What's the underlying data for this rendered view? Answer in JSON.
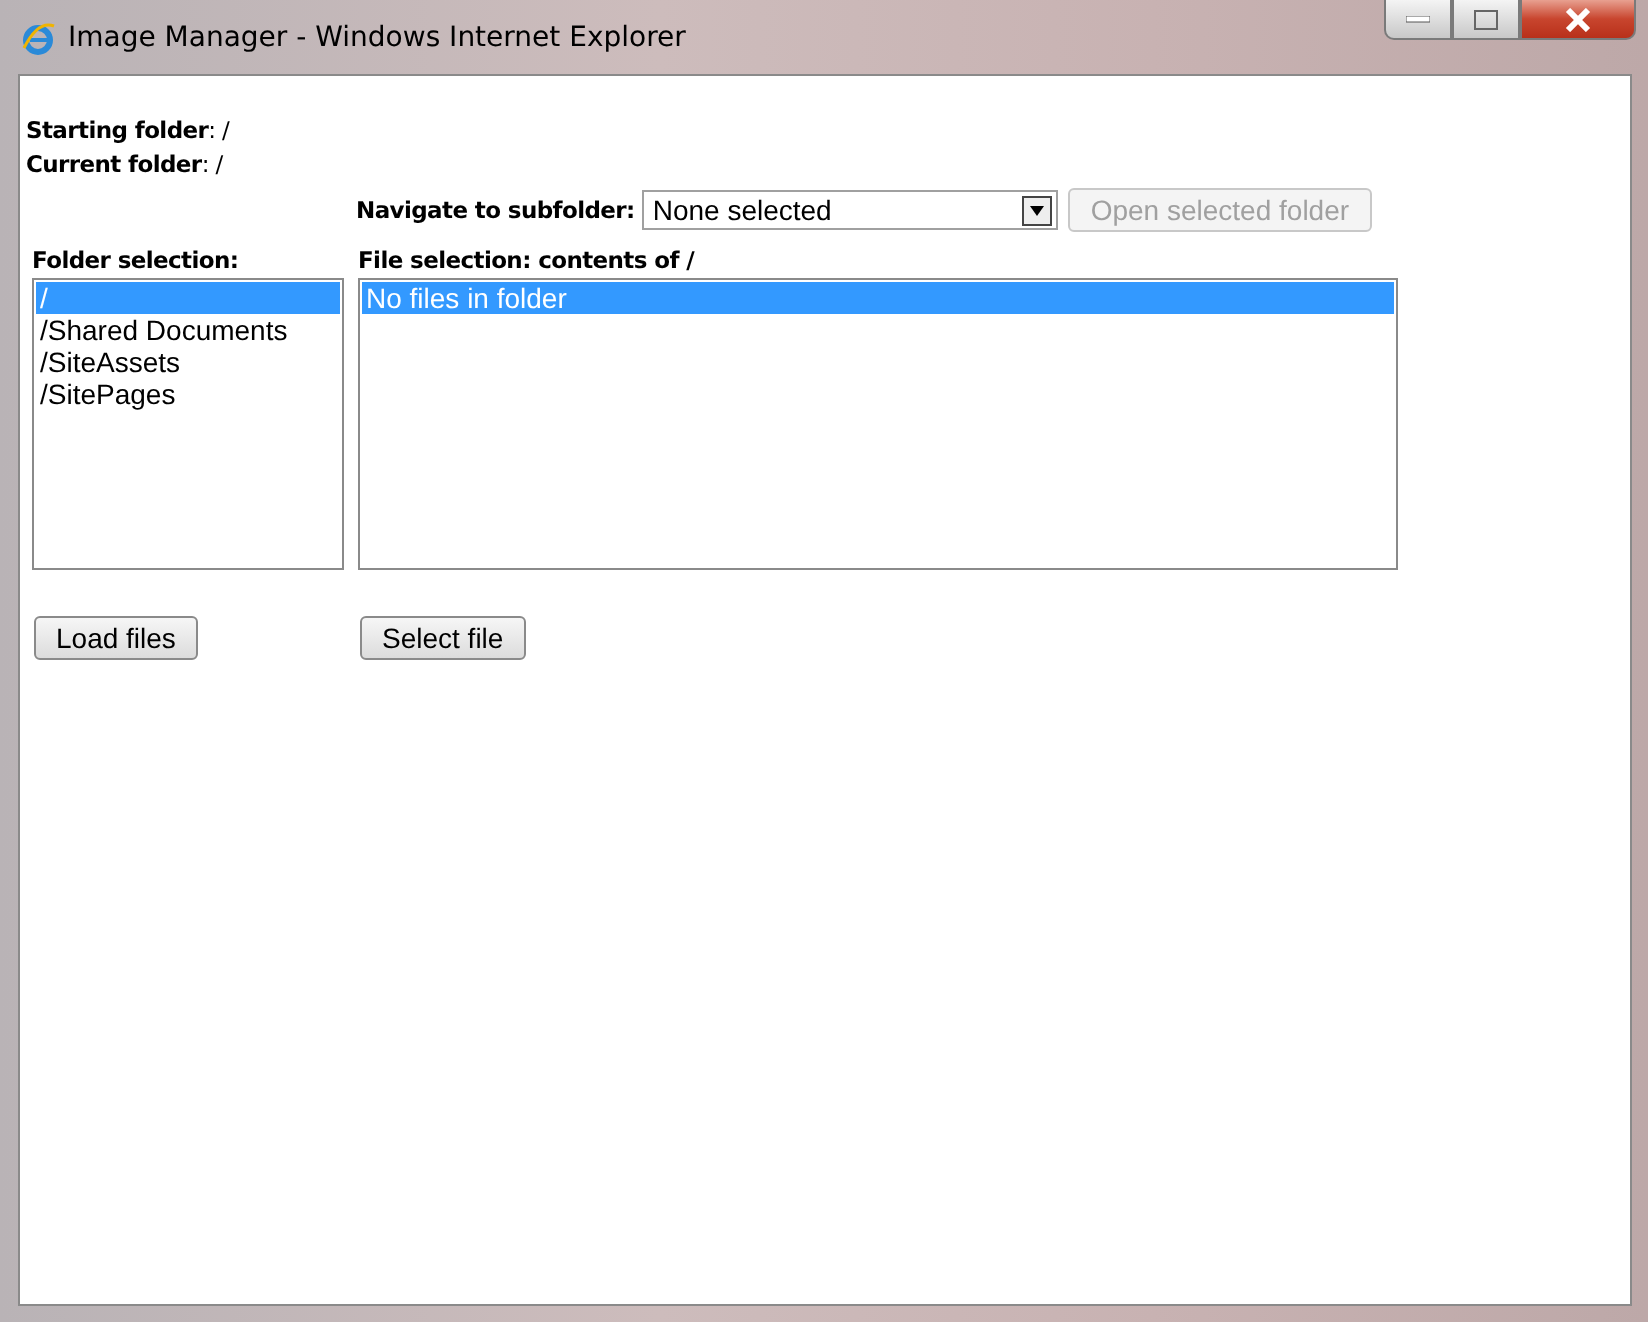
{
  "window": {
    "title": "Image Manager - Windows Internet Explorer"
  },
  "info": [
    "**Starting folder**: /",
    "**Current folder**: /"
  ],
  "navigate": {
    "label": "Navigate to subfolder:",
    "value": "None selected",
    "button": {
      "label": "Open selected folder",
      "disabled": true
    }
  },
  "folders": {
    "label": "Folder selection:",
    "items": [
      {
        "name": "/",
        "selected": true
      },
      {
        "name": "/Shared Documents",
        "selected": false
      },
      {
        "name": "/SiteAssets",
        "selected": false
      },
      {
        "name": "/SitePages",
        "selected": false
      }
    ],
    "button": "Load files"
  },
  "files": {
    "label": "File selection: contents of /",
    "items": [
      {
        "name": "No files in folder",
        "selected": true
      }
    ],
    "button": "Select file"
  }
}
